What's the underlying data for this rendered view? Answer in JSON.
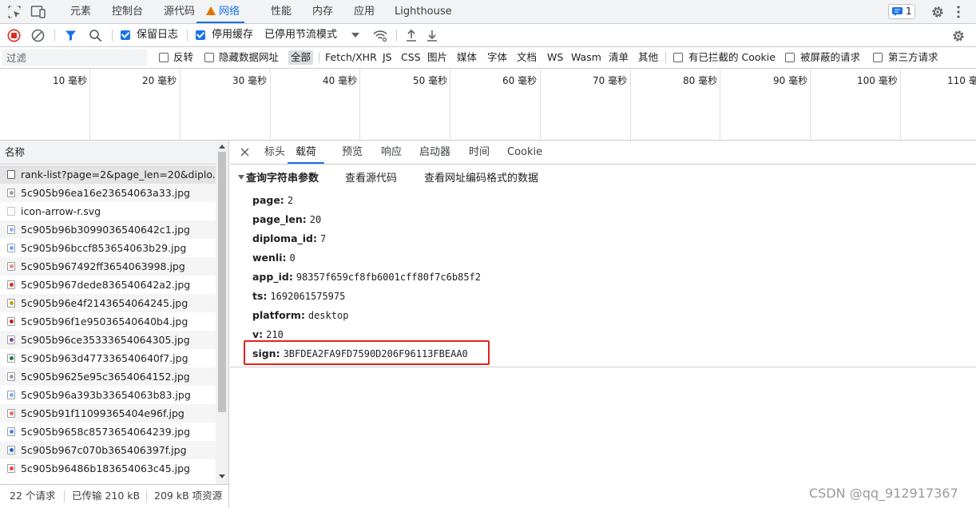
{
  "top_tabs": [
    {
      "label": "元素"
    },
    {
      "label": "控制台"
    },
    {
      "label": "源代码"
    },
    {
      "label": "网络"
    },
    {
      "label": "性能"
    },
    {
      "label": "内存"
    },
    {
      "label": "应用"
    },
    {
      "label": "Lighthouse"
    }
  ],
  "issues_badge": "1",
  "toolbar": {
    "preserve_log": "保留日志",
    "disable_cache": "停用缓存",
    "throttle": "已停用节流模式"
  },
  "filter": {
    "placeholder": "过滤",
    "invert": "反转",
    "hide_data_urls": "隐藏数据网址",
    "types": [
      "全部",
      "Fetch/XHR",
      "JS",
      "CSS",
      "图片",
      "媒体",
      "字体",
      "文档",
      "WS",
      "Wasm",
      "清单",
      "其他"
    ],
    "blocked_cookies": "有已拦截的 Cookie",
    "blocked_requests": "被屏蔽的请求",
    "third_party": "第三方请求"
  },
  "timeline": {
    "ticks": [
      "10 毫秒",
      "20 毫秒",
      "30 毫秒",
      "40 毫秒",
      "50 毫秒",
      "60 毫秒",
      "70 毫秒",
      "80 毫秒",
      "90 毫秒",
      "100 毫秒",
      "110 毫"
    ]
  },
  "request_list": {
    "header": "名称",
    "items": [
      "rank-list?page=2&page_len=20&diplo...",
      "5c905b96ea16e23654063a33.jpg",
      "icon-arrow-r.svg",
      "5c905b96b3099036540642c1.jpg",
      "5c905b96bccf853654063b29.jpg",
      "5c905b967492ff3654063998.jpg",
      "5c905b967dede836540642a2.jpg",
      "5c905b96e4f2143654064245.jpg",
      "5c905b96f1e95036540640b4.jpg",
      "5c905b96ce35333654064305.jpg",
      "5c905b963d477336540640f7.jpg",
      "5c905b9625e95c3654064152.jpg",
      "5c905b96a393b33654063b83.jpg",
      "5c905b91f11099365404e96f.jpg",
      "5c905b9658c8573654064239.jpg",
      "5c905b967c070b365406397f.jpg",
      "5c905b96486b183654063c45.jpg"
    ]
  },
  "status": {
    "requests": "22 个请求",
    "transferred": "已传输 210 kB",
    "resources": "209 kB 项资源"
  },
  "detail_tabs": [
    "标头",
    "载荷",
    "预览",
    "响应",
    "启动器",
    "时间",
    "Cookie"
  ],
  "payload": {
    "section_title": "查询字符串参数",
    "view_source": "查看源代码",
    "view_url_encoded": "查看网址编码格式的数据",
    "params": [
      {
        "key": "page:",
        "value": "2"
      },
      {
        "key": "page_len:",
        "value": "20"
      },
      {
        "key": "diploma_id:",
        "value": "7"
      },
      {
        "key": "wenli:",
        "value": "0"
      },
      {
        "key": "app_id:",
        "value": "98357f659cf8fb6001cff80f7c6b85f2"
      },
      {
        "key": "ts:",
        "value": "1692061575975"
      },
      {
        "key": "platform:",
        "value": "desktop"
      },
      {
        "key": "v:",
        "value": "210"
      },
      {
        "key": "sign:",
        "value": "3BFDEA2FA9FD7590D206F96113FBEAA0"
      }
    ]
  },
  "watermark": "CSDN @qq_912917367",
  "colors": {
    "accent": "#1a73e8",
    "record": "#d93025",
    "highlight_box": "#e2231a",
    "warning": "#e37400"
  }
}
